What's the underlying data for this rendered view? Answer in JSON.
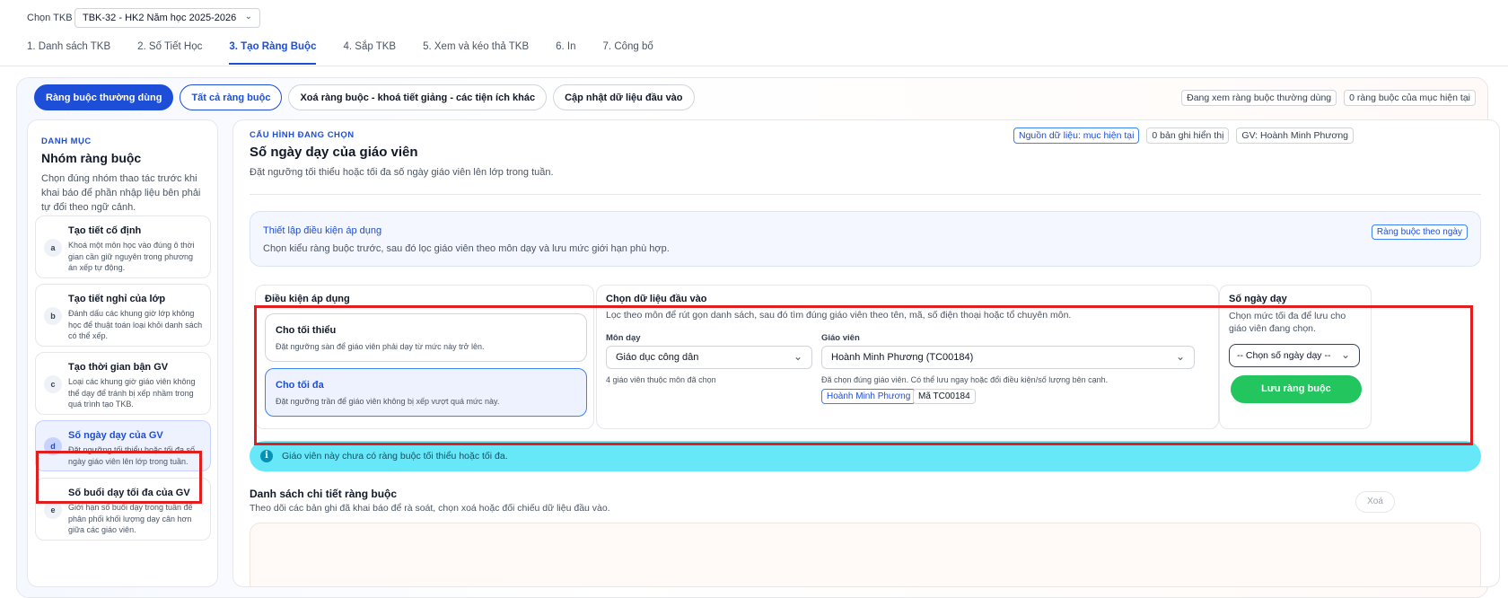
{
  "header": {
    "tkb_label": "Chọn TKB",
    "tkb_value": "TBK-32 - HK2 Năm học 2025-2026",
    "steps": [
      "1. Danh sách TKB",
      "2. Số Tiết Học",
      "3. Tạo Ràng Buộc",
      "4. Sắp TKB",
      "5. Xem và kéo thả TKB",
      "6. In",
      "7. Công bố"
    ],
    "active_step": 2
  },
  "toolbar": {
    "btn_common": "Ràng buộc thường dùng",
    "btn_all": "Tất cả ràng buộc",
    "btn_delete": "Xoá ràng buộc - khoá tiết giảng - các tiện ích khác",
    "btn_update": "Cập nhật dữ liệu đầu vào",
    "status_view": "Đang xem ràng buộc thường dùng",
    "status_count": "0 ràng buộc của mục hiện tại"
  },
  "sidebar": {
    "category": "DANH MỤC",
    "title": "Nhóm ràng buộc",
    "desc": "Chọn đúng nhóm thao tác trước khi khai báo để phần nhập liệu bên phải tự đổi theo ngữ cảnh.",
    "items": [
      {
        "letter": "a",
        "name": "Tạo tiết cố định",
        "desc": "Khoá một môn học vào đúng ô thời gian cần giữ nguyên trong phương án xếp tự động."
      },
      {
        "letter": "b",
        "name": "Tạo tiết nghỉ của lớp",
        "desc": "Đánh dấu các khung giờ lớp không học để thuật toán loại khỏi danh sách có thể xếp."
      },
      {
        "letter": "c",
        "name": "Tạo thời gian bận GV",
        "desc": "Loại các khung giờ giáo viên không thể dạy để tránh bị xếp nhầm trong quá trình tạo TKB."
      },
      {
        "letter": "d",
        "name": "Số ngày dạy của GV",
        "desc": "Đặt ngưỡng tối thiểu hoặc tối đa số ngày giáo viên lên lớp trong tuần."
      },
      {
        "letter": "e",
        "name": "Số buổi dạy tối đa của GV",
        "desc": "Giới hạn số buổi dạy trong tuần để phân phối khối lượng dạy cân hơn giữa các giáo viên."
      }
    ]
  },
  "main": {
    "category": "CẤU HÌNH ĐANG CHỌN",
    "title": "Số ngày dạy của giáo viên",
    "desc": "Đặt ngưỡng tối thiểu hoặc tối đa số ngày giáo viên lên lớp trong tuần.",
    "pill_source": "Nguồn dữ liệu: mục hiện tại",
    "pill_records": "0 bản ghi hiển thị",
    "pill_teacher": "GV: Hoành Minh Phương",
    "setup": {
      "title": "Thiết lập điều kiện áp dụng",
      "desc": "Chọn kiểu ràng buộc trước, sau đó lọc giáo viên theo môn dạy và lưu mức giới hạn phù hợp.",
      "pill": "Ràng buộc theo ngày"
    },
    "condition": {
      "heading": "Điều kiện áp dụng",
      "min_title": "Cho tối thiểu",
      "min_desc": "Đặt ngưỡng sàn để giáo viên phải dạy từ mức này trở lên.",
      "max_title": "Cho tối đa",
      "max_desc": "Đặt ngưỡng trần để giáo viên không bị xếp vượt quá mức này."
    },
    "input": {
      "heading": "Chọn dữ liệu đầu vào",
      "desc": "Lọc theo môn để rút gọn danh sách, sau đó tìm đúng giáo viên theo tên, mã, số điện thoại hoặc tổ chuyên môn.",
      "subject_label": "Môn dạy",
      "subject_value": "Giáo dục công dân",
      "subject_note": "4 giáo viên thuộc môn đã chọn",
      "teacher_label": "Giáo viên",
      "teacher_value": "Hoành Minh Phương (TC00184)",
      "teacher_note": "Đã chọn đúng giáo viên. Có thể lưu ngay hoặc đổi điều kiện/số lượng bên cạnh.",
      "tag_name": "Hoành Minh Phương",
      "tag_code": "Mã TC00184"
    },
    "days": {
      "heading": "Số ngày dạy",
      "desc": "Chọn mức tối đa để lưu cho giáo viên đang chọn.",
      "select_placeholder": "-- Chọn số ngày dạy --",
      "save_label": "Lưu ràng buộc"
    },
    "notice": "Giáo viên này chưa có ràng buộc tối thiểu hoặc tối đa.",
    "list_title": "Danh sách chi tiết ràng buộc",
    "list_desc": "Theo dõi các bản ghi đã khai báo để rà soát, chọn xoá hoặc đối chiếu dữ liệu đầu vào.",
    "delete_label": "Xoá"
  },
  "colors": {
    "accent": "#1d4ed8",
    "save_green": "#22c55e",
    "notice_cyan": "#67e8f9",
    "highlight_red": "#e11d1d"
  }
}
